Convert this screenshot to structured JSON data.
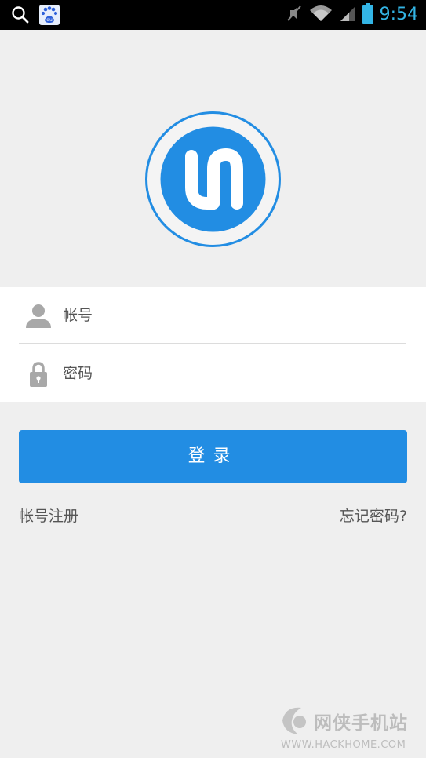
{
  "status_bar": {
    "time": "9:54",
    "icons": [
      "search-icon",
      "baidu-icon",
      "mute-icon",
      "wifi-icon",
      "signal-icon",
      "battery-icon"
    ],
    "time_color": "#33b5e5"
  },
  "logo": {
    "icon": "app-logo",
    "color": "#228de3"
  },
  "login_form": {
    "username_placeholder": "帐号",
    "password_placeholder": "密码",
    "username_icon": "user-icon",
    "password_icon": "lock-icon"
  },
  "login_button": {
    "label": "登录",
    "color": "#228de3"
  },
  "links": {
    "register": "帐号注册",
    "forgot_password": "忘记密码?"
  },
  "watermark": {
    "name": "网侠手机站",
    "url": "WWW.HACKHOME.COM"
  }
}
